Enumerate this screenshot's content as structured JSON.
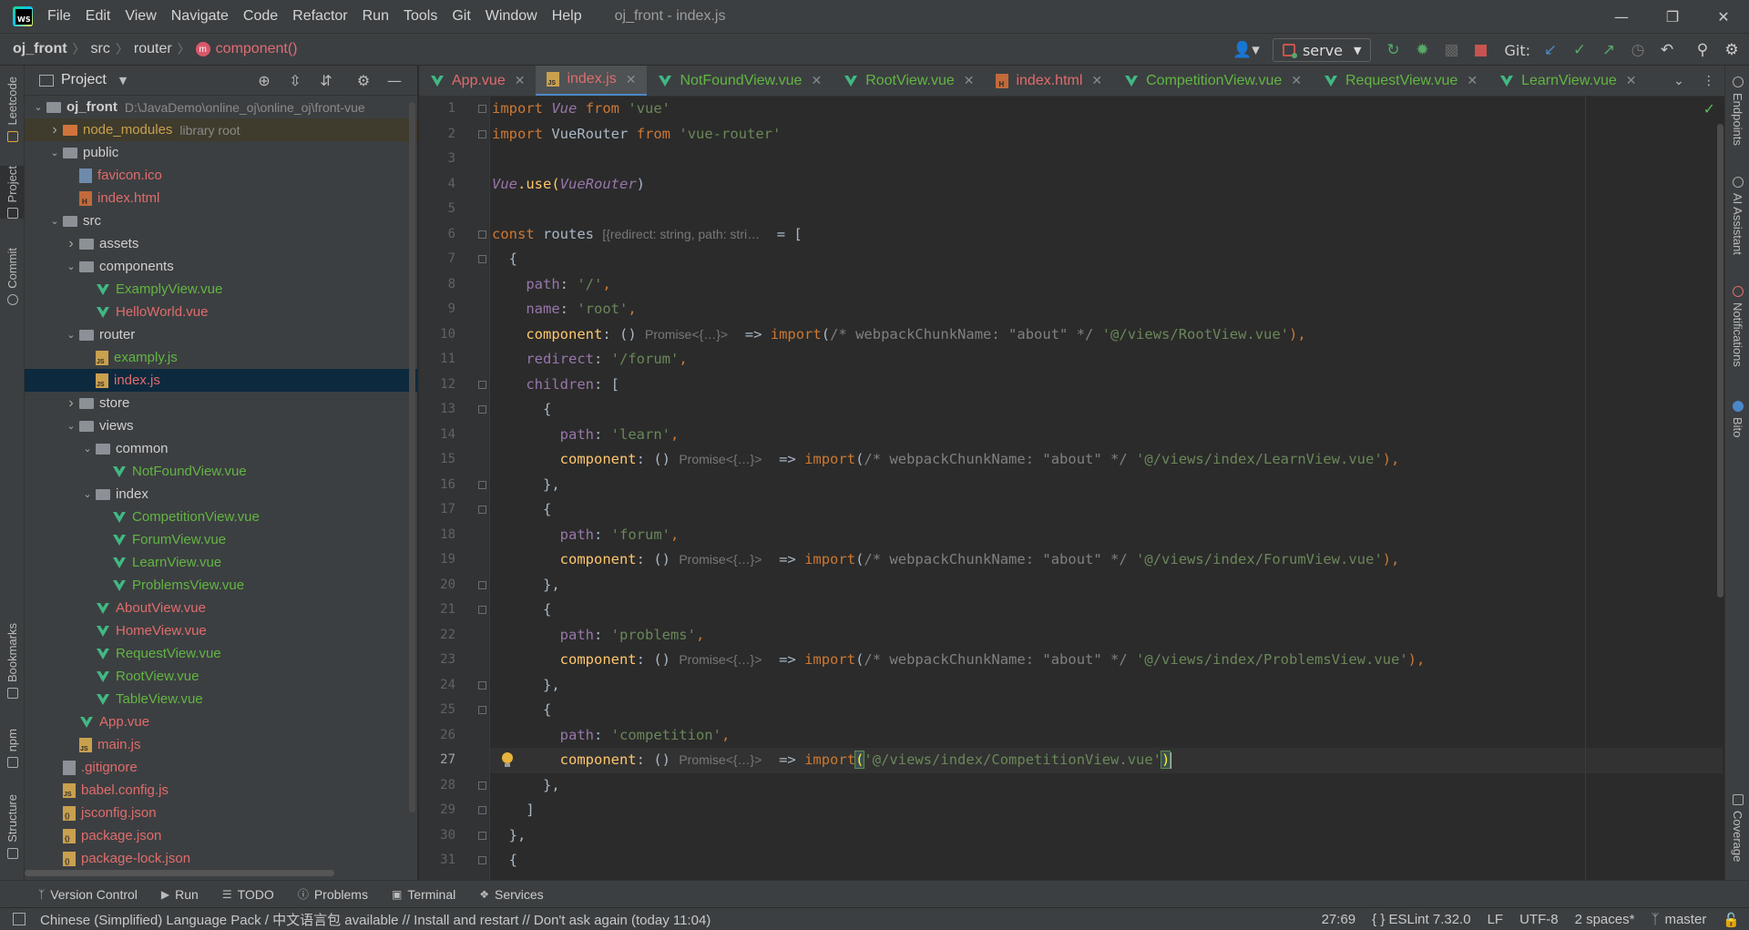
{
  "menubar": {
    "items": [
      "File",
      "Edit",
      "View",
      "Navigate",
      "Code",
      "Refactor",
      "Run",
      "Tools",
      "Git",
      "Window",
      "Help"
    ],
    "window_title": "oj_front - index.js"
  },
  "breadcrumb": {
    "items": [
      "oj_front",
      "src",
      "router"
    ],
    "last": "component()"
  },
  "toolbar": {
    "run_config": "serve",
    "git_label": "Git:"
  },
  "left_tools": [
    "Leetcode",
    "Project",
    "Commit",
    "Bookmarks",
    "npm",
    "Structure"
  ],
  "right_tools": [
    "Endpoints",
    "AI Assistant",
    "Notifications",
    "Bito",
    "Coverage"
  ],
  "project": {
    "title": "Project",
    "tree": [
      {
        "name": "oj_front",
        "hint": "D:\\JavaDemo\\online_oj\\online_oj\\front-vue",
        "depth": 0,
        "expanded": true,
        "icon": "folder",
        "color": "plain"
      },
      {
        "name": "node_modules",
        "hint": "library root",
        "depth": 1,
        "expanded": false,
        "icon": "folder-orange",
        "color": "yellow"
      },
      {
        "name": "public",
        "depth": 1,
        "expanded": true,
        "icon": "folder",
        "color": "plain"
      },
      {
        "name": "favicon.ico",
        "depth": 2,
        "icon": "ico-file",
        "color": "red"
      },
      {
        "name": "index.html",
        "depth": 2,
        "icon": "html",
        "color": "red"
      },
      {
        "name": "src",
        "depth": 1,
        "expanded": true,
        "icon": "folder",
        "color": "plain"
      },
      {
        "name": "assets",
        "depth": 2,
        "expanded": false,
        "icon": "folder",
        "color": "plain"
      },
      {
        "name": "components",
        "depth": 2,
        "expanded": true,
        "icon": "folder",
        "color": "plain"
      },
      {
        "name": "ExamplyView.vue",
        "depth": 3,
        "icon": "vue",
        "color": "green"
      },
      {
        "name": "HelloWorld.vue",
        "depth": 3,
        "icon": "vue",
        "color": "red"
      },
      {
        "name": "router",
        "depth": 2,
        "expanded": true,
        "icon": "folder",
        "color": "plain"
      },
      {
        "name": "examply.js",
        "depth": 3,
        "icon": "js",
        "color": "green"
      },
      {
        "name": "index.js",
        "depth": 3,
        "icon": "js",
        "color": "red",
        "selected": true
      },
      {
        "name": "store",
        "depth": 2,
        "expanded": false,
        "icon": "folder",
        "color": "plain"
      },
      {
        "name": "views",
        "depth": 2,
        "expanded": true,
        "icon": "folder",
        "color": "plain"
      },
      {
        "name": "common",
        "depth": 3,
        "expanded": true,
        "icon": "folder",
        "color": "plain"
      },
      {
        "name": "NotFoundView.vue",
        "depth": 4,
        "icon": "vue",
        "color": "green"
      },
      {
        "name": "index",
        "depth": 3,
        "expanded": true,
        "icon": "folder",
        "color": "plain"
      },
      {
        "name": "CompetitionView.vue",
        "depth": 4,
        "icon": "vue",
        "color": "green"
      },
      {
        "name": "ForumView.vue",
        "depth": 4,
        "icon": "vue",
        "color": "green"
      },
      {
        "name": "LearnView.vue",
        "depth": 4,
        "icon": "vue",
        "color": "green"
      },
      {
        "name": "ProblemsView.vue",
        "depth": 4,
        "icon": "vue",
        "color": "green"
      },
      {
        "name": "AboutView.vue",
        "depth": 3,
        "icon": "vue",
        "color": "red"
      },
      {
        "name": "HomeView.vue",
        "depth": 3,
        "icon": "vue",
        "color": "red"
      },
      {
        "name": "RequestView.vue",
        "depth": 3,
        "icon": "vue",
        "color": "green"
      },
      {
        "name": "RootView.vue",
        "depth": 3,
        "icon": "vue",
        "color": "green"
      },
      {
        "name": "TableView.vue",
        "depth": 3,
        "icon": "vue",
        "color": "green"
      },
      {
        "name": "App.vue",
        "depth": 2,
        "icon": "vue",
        "color": "red"
      },
      {
        "name": "main.js",
        "depth": 2,
        "icon": "js",
        "color": "red"
      },
      {
        "name": ".gitignore",
        "depth": 1,
        "icon": "git",
        "color": "red"
      },
      {
        "name": "babel.config.js",
        "depth": 1,
        "icon": "js",
        "color": "red"
      },
      {
        "name": "jsconfig.json",
        "depth": 1,
        "icon": "json",
        "color": "red"
      },
      {
        "name": "package.json",
        "depth": 1,
        "icon": "json",
        "color": "red"
      },
      {
        "name": "package-lock.json",
        "depth": 1,
        "icon": "json",
        "color": "red"
      }
    ]
  },
  "tabs": [
    {
      "label": "App.vue",
      "icon": "vue",
      "color": "red"
    },
    {
      "label": "index.js",
      "icon": "js",
      "color": "red",
      "active": true
    },
    {
      "label": "NotFoundView.vue",
      "icon": "vue",
      "color": "green"
    },
    {
      "label": "RootView.vue",
      "icon": "vue",
      "color": "green"
    },
    {
      "label": "index.html",
      "icon": "html",
      "color": "red"
    },
    {
      "label": "CompetitionView.vue",
      "icon": "vue",
      "color": "green"
    },
    {
      "label": "RequestView.vue",
      "icon": "vue",
      "color": "green"
    },
    {
      "label": "LearnView.vue",
      "icon": "vue",
      "color": "green"
    }
  ],
  "editor": {
    "current_line": 27,
    "line_numbers": [
      "1",
      "2",
      "3",
      "4",
      "5",
      "6",
      "7",
      "8",
      "9",
      "10",
      "11",
      "12",
      "13",
      "14",
      "15",
      "16",
      "17",
      "18",
      "19",
      "20",
      "21",
      "22",
      "23",
      "24",
      "25",
      "26",
      "27",
      "28",
      "29",
      "30",
      "31"
    ],
    "hints": {
      "routes_type": "[{redirect: string, path: stri…",
      "promise": "Promise<{…}>"
    },
    "code": {
      "l1": [
        "import",
        "Vue",
        "from",
        "'vue'"
      ],
      "l2": [
        "import",
        "VueRouter",
        "from",
        "'vue-router'"
      ],
      "l4": [
        "Vue",
        ".use(",
        "VueRouter",
        ")"
      ],
      "l6": [
        "const",
        "routes",
        "= ["
      ],
      "l7": "{",
      "l8": [
        "path",
        ": ",
        "'/'",
        ","
      ],
      "l9": [
        "name",
        ": ",
        "'root'",
        ","
      ],
      "l10": [
        "component",
        ": ()",
        "=> ",
        "import",
        "(",
        "/* webpackChunkName: \"about\" */",
        " ",
        "'@/views/RootView.vue'",
        "),"
      ],
      "l11": [
        "redirect",
        ": ",
        "'/forum'",
        ","
      ],
      "l12": [
        "children",
        ": ["
      ],
      "l13": "{",
      "l14": [
        "path",
        ": ",
        "'learn'",
        ","
      ],
      "l15": [
        "component",
        ": ()",
        "=> ",
        "import",
        "(",
        "/* webpackChunkName: \"about\" */",
        " ",
        "'@/views/index/LearnView.vue'",
        "),"
      ],
      "l16": "},",
      "l17": "{",
      "l18": [
        "path",
        ": ",
        "'forum'",
        ","
      ],
      "l19": [
        "component",
        ": ()",
        "=> ",
        "import",
        "(",
        "/* webpackChunkName: \"about\" */",
        " ",
        "'@/views/index/ForumView.vue'",
        "),"
      ],
      "l20": "},",
      "l21": "{",
      "l22": [
        "path",
        ": ",
        "'problems'",
        ","
      ],
      "l23": [
        "component",
        ": ()",
        "=> ",
        "import",
        "(",
        "/* webpackChunkName: \"about\" */",
        " ",
        "'@/views/index/ProblemsView.vue'",
        "),"
      ],
      "l24": "},",
      "l25": "{",
      "l26": [
        "path",
        ": ",
        "'competition'",
        ","
      ],
      "l27": [
        "component",
        ": ()",
        "=> ",
        "import",
        "(",
        "'@/views/index/CompetitionView.vue'",
        ")"
      ],
      "l28": "},",
      "l29": "]",
      "l30": "},",
      "l31": "{"
    }
  },
  "toolwindows": [
    "Version Control",
    "Run",
    "TODO",
    "Problems",
    "Terminal",
    "Services"
  ],
  "status": {
    "message": "Chinese (Simplified) Language Pack / 中文语言包 available // Install and restart // Don't ask again (today 11:04)",
    "position": "27:69",
    "eslint": "{ } ESLint 7.32.0",
    "line_sep": "LF",
    "encoding": "UTF-8",
    "indent": "2 spaces*",
    "branch": "master"
  },
  "colors": {
    "accent": "#4a88c7",
    "vcs_green": "#62b543",
    "vcs_red": "#e06c6c"
  }
}
